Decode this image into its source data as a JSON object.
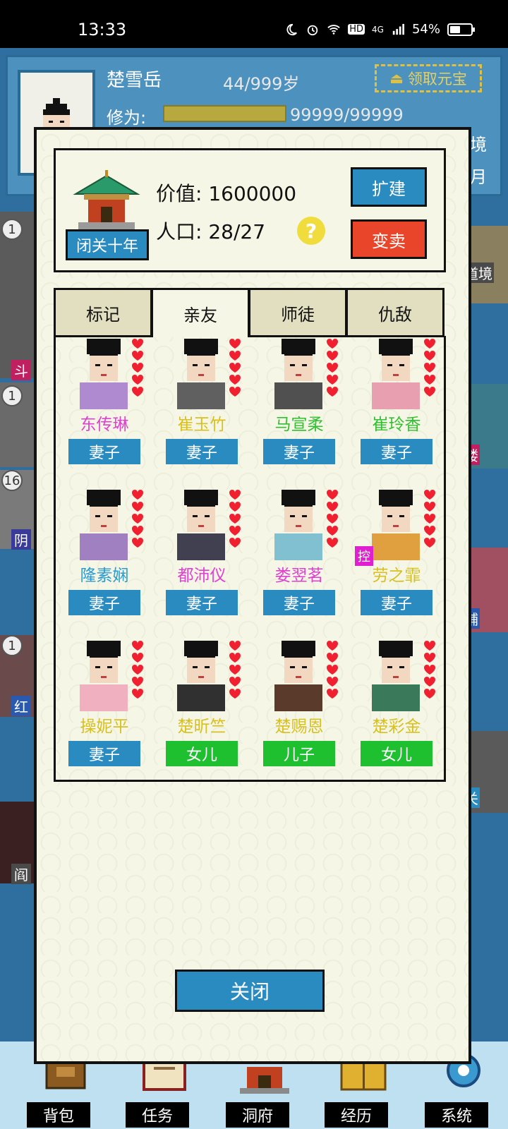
{
  "status_bar": {
    "time": "13:33",
    "network": "4G",
    "hd": "HD",
    "battery": "54%"
  },
  "background": {
    "player_name": "楚雪岳",
    "age": "44/999岁",
    "claim_label": "领取元宝",
    "xiuwei_label": "修为:",
    "xiuwei_value": "99999/99999",
    "right_text_1": "境",
    "right_text_2": "月",
    "left_badges": [
      "1",
      "1",
      "16",
      "1"
    ],
    "left_labels": [
      "斗",
      "阴",
      "红",
      "阎"
    ],
    "right_labels": [
      "道境",
      "楼",
      "铺",
      "关"
    ]
  },
  "modal": {
    "value_label": "价值:",
    "value": "1600000",
    "population_label": "人口:",
    "population": "28/27",
    "help_symbol": "?",
    "seclusion_label": "闭关十年",
    "expand_label": "扩建",
    "sell_label": "变卖",
    "close_label": "关闭",
    "tabs": [
      {
        "label": "标记"
      },
      {
        "label": "亲友"
      },
      {
        "label": "师徒"
      },
      {
        "label": "仇敌"
      }
    ],
    "active_tab": "亲友",
    "members": [
      {
        "name": "东传琳",
        "role": "妻子",
        "name_color": "#e040d0",
        "role_color": "#2a8bc0"
      },
      {
        "name": "崔玉竹",
        "role": "妻子",
        "name_color": "#d8c020",
        "role_color": "#2a8bc0"
      },
      {
        "name": "马宣柔",
        "role": "妻子",
        "name_color": "#30c030",
        "role_color": "#2a8bc0"
      },
      {
        "name": "崔玲香",
        "role": "妻子",
        "name_color": "#30c030",
        "role_color": "#2a8bc0"
      },
      {
        "name": "隆素娴",
        "role": "妻子",
        "name_color": "#2a9bd0",
        "role_color": "#2a8bc0"
      },
      {
        "name": "都沛仪",
        "role": "妻子",
        "name_color": "#e040d0",
        "role_color": "#2a8bc0"
      },
      {
        "name": "娄翌茗",
        "role": "妻子",
        "name_color": "#e040d0",
        "role_color": "#2a8bc0"
      },
      {
        "name": "劳之霏",
        "role": "妻子",
        "name_color": "#d8c020",
        "role_color": "#2a8bc0",
        "tag": "控"
      },
      {
        "name": "操妮平",
        "role": "妻子",
        "name_color": "#d8c020",
        "role_color": "#2a8bc0"
      },
      {
        "name": "楚昕竺",
        "role": "女儿",
        "name_color": "#d8c020",
        "role_color": "#1ec030"
      },
      {
        "name": "楚赐恩",
        "role": "儿子",
        "name_color": "#d8c020",
        "role_color": "#1ec030"
      },
      {
        "name": "楚彩金",
        "role": "女儿",
        "name_color": "#d8c020",
        "role_color": "#1ec030"
      }
    ]
  },
  "bottom_nav": [
    {
      "label": "背包",
      "icon": "backpack-icon"
    },
    {
      "label": "任务",
      "icon": "scroll-icon"
    },
    {
      "label": "洞府",
      "icon": "pavilion-icon"
    },
    {
      "label": "经历",
      "icon": "book-icon"
    },
    {
      "label": "系统",
      "icon": "gear-icon"
    }
  ]
}
